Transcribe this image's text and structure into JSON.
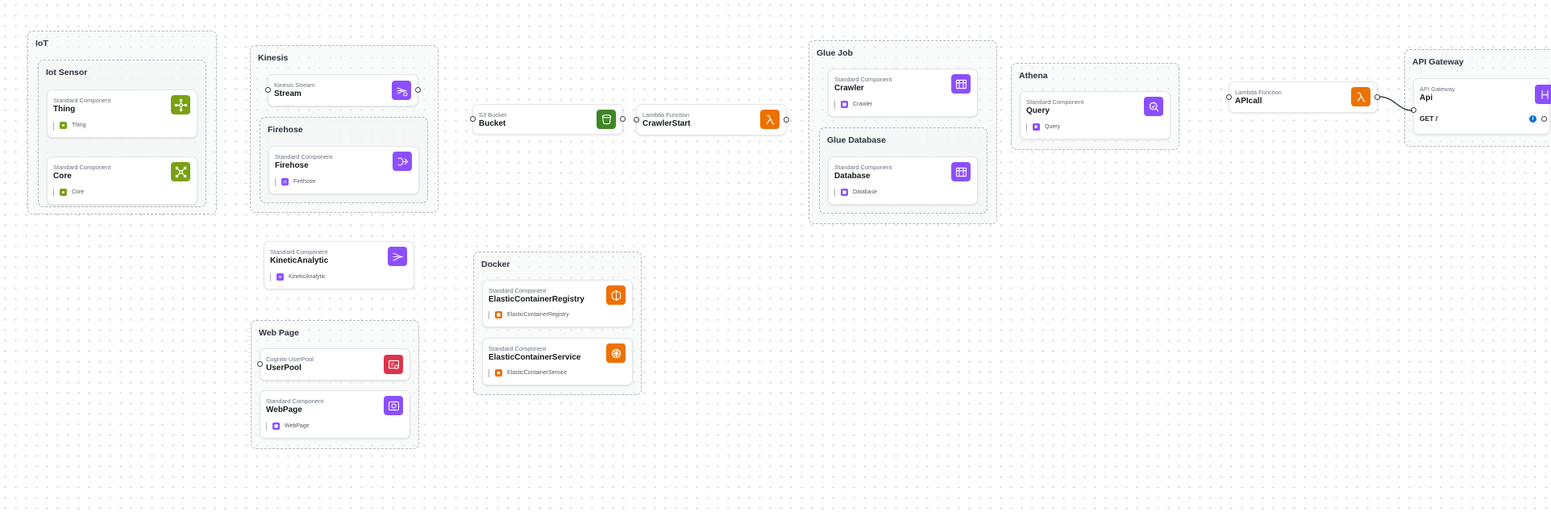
{
  "colors": {
    "iot": "#7aa116",
    "analytics": "#8c4fff",
    "storage": "#3f8624",
    "compute": "#ed7100",
    "security": "#dd344c",
    "info": "#0972d3"
  },
  "groups": {
    "iot": "IoT",
    "iot_sensor": "Iot Sensor",
    "kinesis": "Kinesis",
    "firehose": "Firehose",
    "web_page": "Web Page",
    "docker": "Docker",
    "glue_job": "Glue Job",
    "glue_database": "Glue Database",
    "athena": "Athena",
    "api_gateway": "API Gateway"
  },
  "components": {
    "thing": {
      "type": "Standard Component",
      "name": "Thing",
      "tag": "Thing",
      "icon": "iot-thing-icon"
    },
    "core": {
      "type": "Standard Component",
      "name": "Core",
      "tag": "Core",
      "icon": "iot-core-icon"
    },
    "stream": {
      "type": "Kinesis Stream",
      "name": "Stream",
      "icon": "kinesis-stream-icon"
    },
    "firehose": {
      "type": "Standard Component",
      "name": "Firehose",
      "tag": "Firehose",
      "icon": "firehose-icon"
    },
    "kinetic_analytic": {
      "type": "Standard Component",
      "name": "KineticAnalytic",
      "tag": "KineticAnalytic",
      "icon": "kinesis-analytics-icon"
    },
    "user_pool": {
      "type": "Cognito UserPool",
      "name": "UserPool",
      "icon": "cognito-icon"
    },
    "web_page": {
      "type": "Standard Component",
      "name": "WebPage",
      "tag": "WebPage",
      "icon": "web-page-icon"
    },
    "bucket": {
      "type": "S3 Bucket",
      "name": "Bucket",
      "icon": "s3-bucket-icon"
    },
    "crawler_start": {
      "type": "Lambda Function",
      "name": "CrawlerStart",
      "icon": "lambda-icon"
    },
    "ecr": {
      "type": "Standard Component",
      "name": "ElasticContainerRegistry",
      "tag": "ElasticContainerRegistry",
      "icon": "ecr-icon"
    },
    "ecs": {
      "type": "Standard Component",
      "name": "ElasticContainerService",
      "tag": "ElasticContainerService",
      "icon": "ecs-icon"
    },
    "crawler": {
      "type": "Standard Component",
      "name": "Crawler",
      "tag": "Crawler",
      "icon": "glue-crawler-icon"
    },
    "database": {
      "type": "Standard Component",
      "name": "Database",
      "tag": "Database",
      "icon": "glue-database-icon"
    },
    "query": {
      "type": "Standard Component",
      "name": "Query",
      "tag": "Query",
      "icon": "athena-query-icon"
    },
    "apicall": {
      "type": "Lambda Function",
      "name": "APIcall",
      "icon": "lambda-icon"
    },
    "api": {
      "type": "API Gateway",
      "name": "Api",
      "route": "GET /",
      "icon": "api-gateway-icon"
    }
  }
}
